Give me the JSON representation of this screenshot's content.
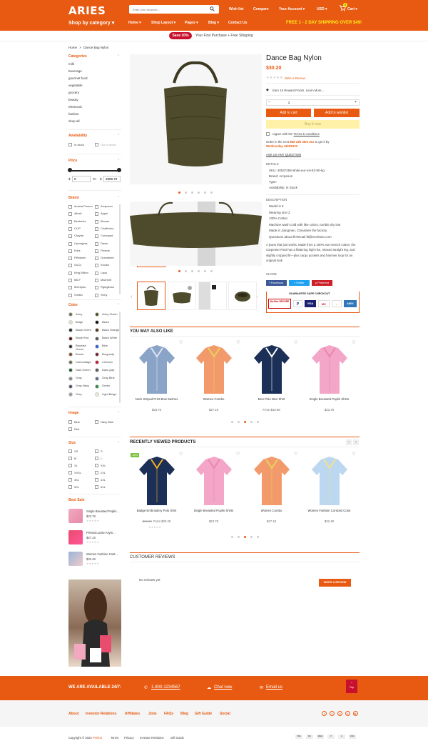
{
  "header": {
    "logo": "ARIES",
    "search_placeholder": "Enter your keyword...",
    "wishlist": "Wish list",
    "compare": "Compare",
    "account": "Your Account",
    "currency": "USD",
    "cart": "Cart",
    "cart_count": "0"
  },
  "nav": {
    "shop_by_category": "Shop by category",
    "items": [
      "Home",
      "Shop Layout",
      "Pages",
      "Blog",
      "Contact Us"
    ],
    "free_shipping": "FREE 1 - 2 DAY SHIPPING OVER $49!"
  },
  "promo": {
    "badge": "Save 30%",
    "text": "Your First Purchase + Free Shipping"
  },
  "breadcrumb": {
    "home": "Home",
    "sep": ">",
    "current": "Dance Bag Nylon"
  },
  "sidebar": {
    "categories_title": "Categories",
    "categories": [
      "milk",
      "beverage",
      "gourmet food",
      "vegetable",
      "grocery",
      "beauty",
      "electronic",
      "fashion",
      "shop all"
    ],
    "availability_title": "Availability",
    "in_stock": "In stock",
    "out_of_stock": "Out of stock",
    "price_title": "Price",
    "price_min": "0",
    "price_to": "To",
    "price_max": "2999.70",
    "currency": "$",
    "brand_title": "Brand",
    "brands": [
      [
        "Acacia Person",
        "Arcpeson"
      ],
      [
        "Allcell",
        "Apple"
      ],
      [
        "Bestertex",
        "Blouse"
      ],
      [
        "CLIP",
        "Chaffenko"
      ],
      [
        "Clwyde",
        "Comopad"
      ],
      [
        "Cpcsejpse",
        "Dawn"
      ],
      [
        "Edra",
        "Fleecie"
      ],
      [
        "Fifthtueln",
        "Grandleeb"
      ],
      [
        "GuCc",
        "Kinoko"
      ],
      [
        "King Billion",
        "Lapa"
      ],
      [
        "MiLF",
        "Maxmint"
      ],
      [
        "Meeepsu",
        "Rgiogliosa"
      ],
      [
        "Smitec",
        "Smry"
      ]
    ],
    "color_title": "Color",
    "colors": [
      [
        "Army",
        "#6f6b4e",
        "Army Green",
        "#4b5320"
      ],
      [
        "Beige",
        "#e9dfc8",
        "Black",
        "#111111"
      ],
      [
        "Black Green",
        "#223322",
        "Black Orange",
        "#553311"
      ],
      [
        "Black Red",
        "#5a1111",
        "Black White",
        "#555555"
      ],
      [
        "Blackish Green",
        "#2b3a2b",
        "Blue",
        "#2a5ed8"
      ],
      [
        "Brown",
        "#7a4a2a",
        "Burgundy",
        "#7a1f2e"
      ],
      [
        "Camouflage",
        "#6b6a4a",
        "Crimson",
        "#c2142e"
      ],
      [
        "Dark Green",
        "#1e5a2e",
        "Dark gray",
        "#555555"
      ],
      [
        "Gray",
        "#888888",
        "Gray Blue",
        "#5a6a8a"
      ],
      [
        "Gray Navy",
        "#4a5068",
        "Green",
        "#2e8b3e"
      ],
      [
        "Grey",
        "#9a9a9a",
        "Light Beige",
        "#efe6d2"
      ]
    ],
    "image_title": "Image",
    "images": [
      [
        "Blue",
        "Navy Blue"
      ],
      [
        "Red",
        ""
      ]
    ],
    "size_title": "Size",
    "sizes": [
      [
        "XS",
        "S"
      ],
      [
        "M",
        "L"
      ],
      [
        "XL",
        "XXL"
      ],
      [
        "XXXL",
        "2XL"
      ],
      [
        "3XL",
        "4XL"
      ],
      [
        "5XL",
        "6XL"
      ]
    ],
    "bestsale_title": "Best Sale",
    "bestsale": [
      {
        "name": "Single Breasted Poplin...",
        "price": "$23.78"
      },
      {
        "name": "Printed Loose Asym...",
        "price": "$27.18"
      },
      {
        "name": "Women Fashion Cont...",
        "price": "$32.48"
      }
    ]
  },
  "product": {
    "title": "Dance Bag Nylon",
    "price": "$30.20",
    "write_review": "Write a Review",
    "reward": "Earn 15 Reward Points.",
    "learn_more": "Learn More...",
    "qty": "1",
    "minus": "−",
    "plus": "+",
    "add_to_cart": "Add to cart",
    "add_to_wishlist": "Add to wishlist",
    "buy_it_now": "Buy it now",
    "agree": "I agree with the",
    "terms": "Terms & conditions",
    "order_text": "Order in the next",
    "countdown": "88d 23h 39m 31s",
    "order_text2": "to get it by",
    "delivery": "Wednesday 16/3/2022",
    "ask": "ASK US ANY QUESTION",
    "details_title": "DETAILS",
    "details": [
      "SKU: 40537258 white-eur-xxl-82-50-kg",
      "Brand: Arcpeson",
      "Type:",
      "Availability: In Stock"
    ],
    "description_title": "DESCRIPTION",
    "description": [
      "Model is 5",
      "Wearing size 2",
      "100% Cotton",
      "Machine wash cold with like colors, tumble dry low",
      "Made in Jiangmen, ChinaSee the factory",
      "Questions about fit?Email fit@everlane.com"
    ],
    "paragraph": "A jeans that just works. Made from a 100% non-stretch cotton, the Carpenter Pant has a flattering high-rise, relaxed straight leg, and slightly cropped fit—plus cargo pockets and hammer loop for an original look.",
    "share_title": "SHARE",
    "facebook": "Facebook",
    "twitter": "Twitter",
    "pinterest": "Pinterest",
    "guarantee": "GUARANTEE SAFE CHECKOUT",
    "mcafee": "McAfee SECURE",
    "paypal": "P",
    "visa": "VISA",
    "mastercard": "MC",
    "amex": "AMEX"
  },
  "also_like": {
    "title": "YOU MAY ALSO LIKE",
    "items": [
      {
        "name": "Neck Striped Print Bow Sashes",
        "price": "$33.70"
      },
      {
        "name": "Women Combo",
        "price": "$27.18"
      },
      {
        "name": "Men Polo Men Shirt",
        "price": "From $19.98"
      },
      {
        "name": "Single Breasted Poplin Shirts",
        "price": "$23.78"
      }
    ]
  },
  "recent": {
    "title": "RECENTLY VIEWED PRODUCTS",
    "badge": "-40%",
    "items": [
      {
        "name": "Badge Embroidery Polo Shirt",
        "old": "$98.29",
        "price": "From $20.29"
      },
      {
        "name": "Single Breasted Poplin Shirts",
        "price": "$23.78"
      },
      {
        "name": "Women Combo",
        "price": "$27.18"
      },
      {
        "name": "Women Fashion Contrast Color",
        "price": "$32.48"
      }
    ]
  },
  "reviews": {
    "title": "CUSTOMER REVIEWS",
    "none": "No reviews yet",
    "write": "WRITE A REVIEW"
  },
  "footer": {
    "available": "WE ARE AVAILABLE 24/7:",
    "phone": "1-800-1234567",
    "chat": "Chat now",
    "email": "Email us",
    "top": "Top",
    "links": [
      "About",
      "Investor Relations",
      "Affiliates",
      "Jobs",
      "FAQs",
      "Blog",
      "Gift Guide",
      "Social"
    ],
    "copyright": "Copyright © 2022",
    "brand": "Perfect",
    "bottom_links": [
      "Terms",
      "Privacy",
      "Investor Relations",
      "Gift Guide"
    ],
    "payments": [
      "VISA",
      "MC",
      "AMEX",
      "P",
      "G",
      "DISC"
    ]
  }
}
